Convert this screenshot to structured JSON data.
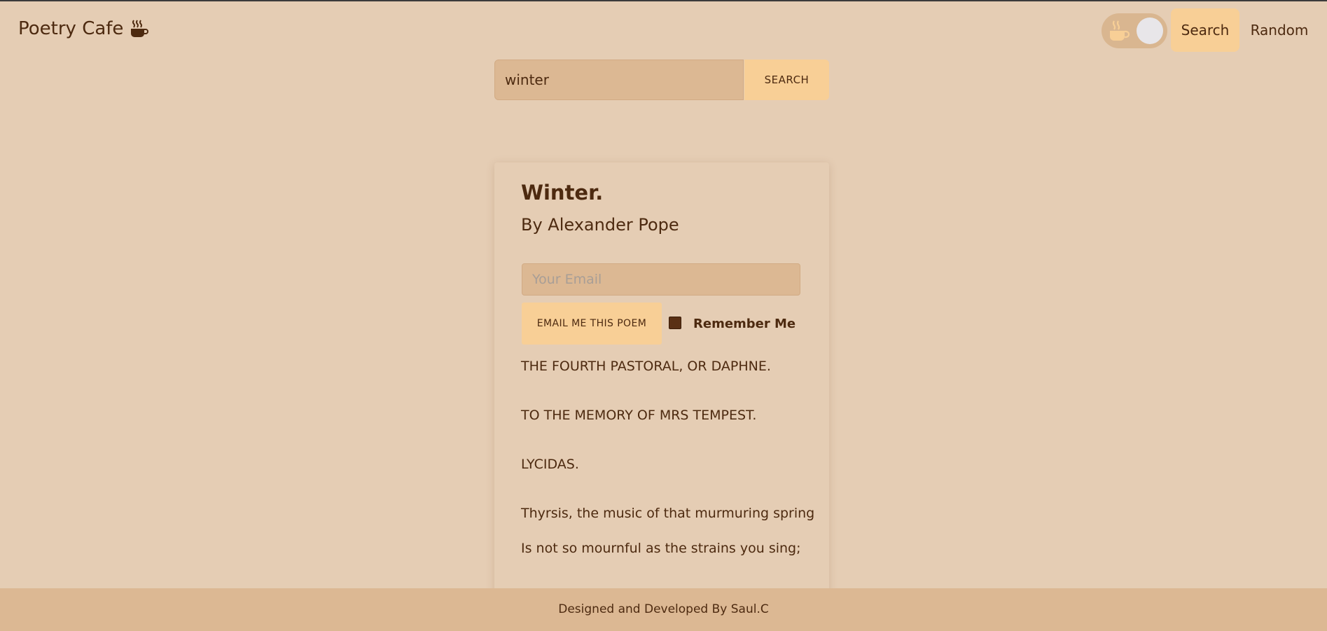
{
  "header": {
    "brand": "Poetry Cafe",
    "brand_icon": "coffee-cup-icon",
    "theme_toggle_icon": "coffee-cup-icon",
    "nav": {
      "search_label": "Search",
      "random_label": "Random"
    }
  },
  "search": {
    "value": "winter",
    "button_label": "SEARCH"
  },
  "poem": {
    "title": "Winter.",
    "author": "By Alexander Pope",
    "email_placeholder": "Your Email",
    "email_button_label": "EMAIL ME THIS POEM",
    "remember_label": "Remember Me",
    "remember_checked": true,
    "lines": [
      "THE FOURTH PASTORAL, OR DAPHNE.",
      "TO THE MEMORY OF MRS TEMPEST.",
      "LYCIDAS.",
      "Thyrsis, the music of that murmuring spring",
      "Is not so mournful as the strains you sing;"
    ]
  },
  "footer": {
    "text": "Designed and Developed By Saul.C"
  },
  "colors": {
    "background": "#e5cdb4",
    "accent": "#f8cf96",
    "input_bg": "#dcb893",
    "text": "#4d2a10"
  }
}
